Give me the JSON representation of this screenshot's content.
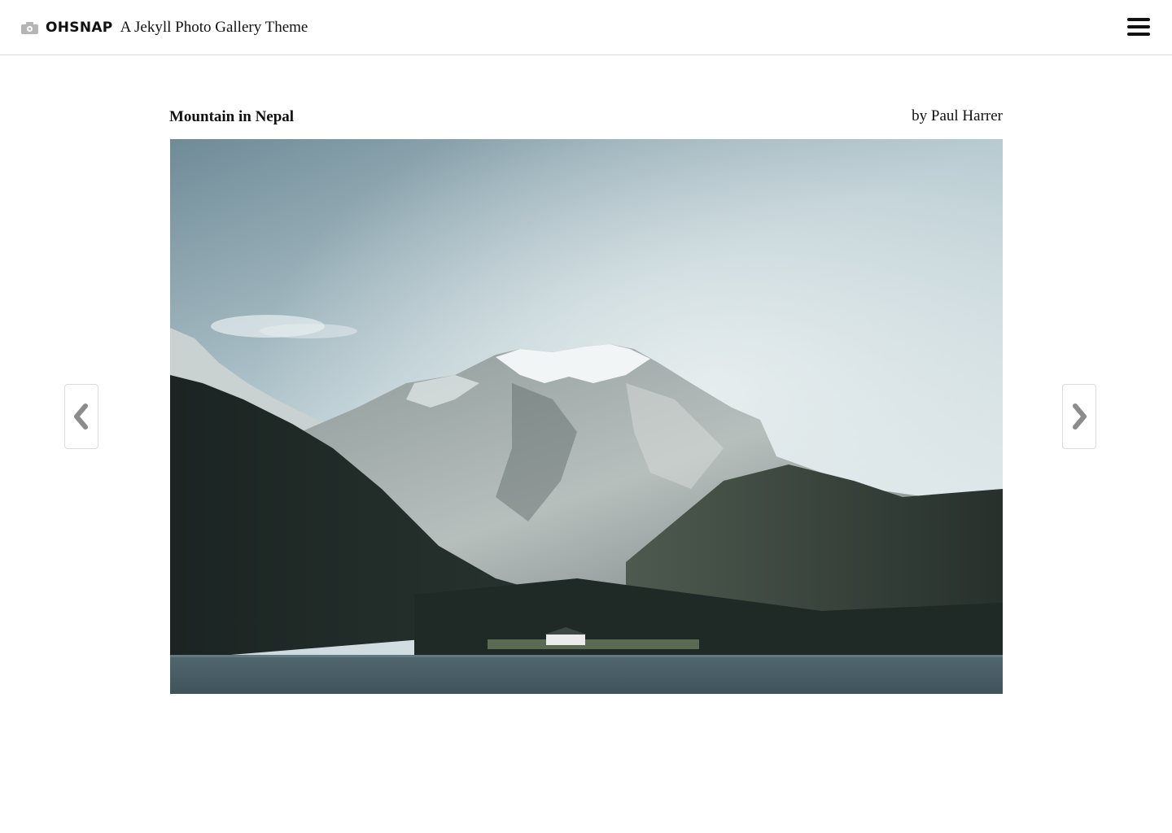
{
  "header": {
    "brand_name": "OHSNAP",
    "tagline": "A Jekyll Photo Gallery Theme",
    "brand_icon": "camera-icon",
    "menu_icon": "hamburger-menu-icon"
  },
  "photo": {
    "title": "Mountain in Nepal",
    "credit": "by Paul Harrer",
    "subject": "mountain-lake-landscape"
  },
  "navigation": {
    "prev_icon": "chevron-left-icon",
    "next_icon": "chevron-right-icon"
  },
  "colors": {
    "accent_icon": "#b5b5b5",
    "nav_chevron": "#8c8c8c",
    "border": "#dcdcdc"
  }
}
